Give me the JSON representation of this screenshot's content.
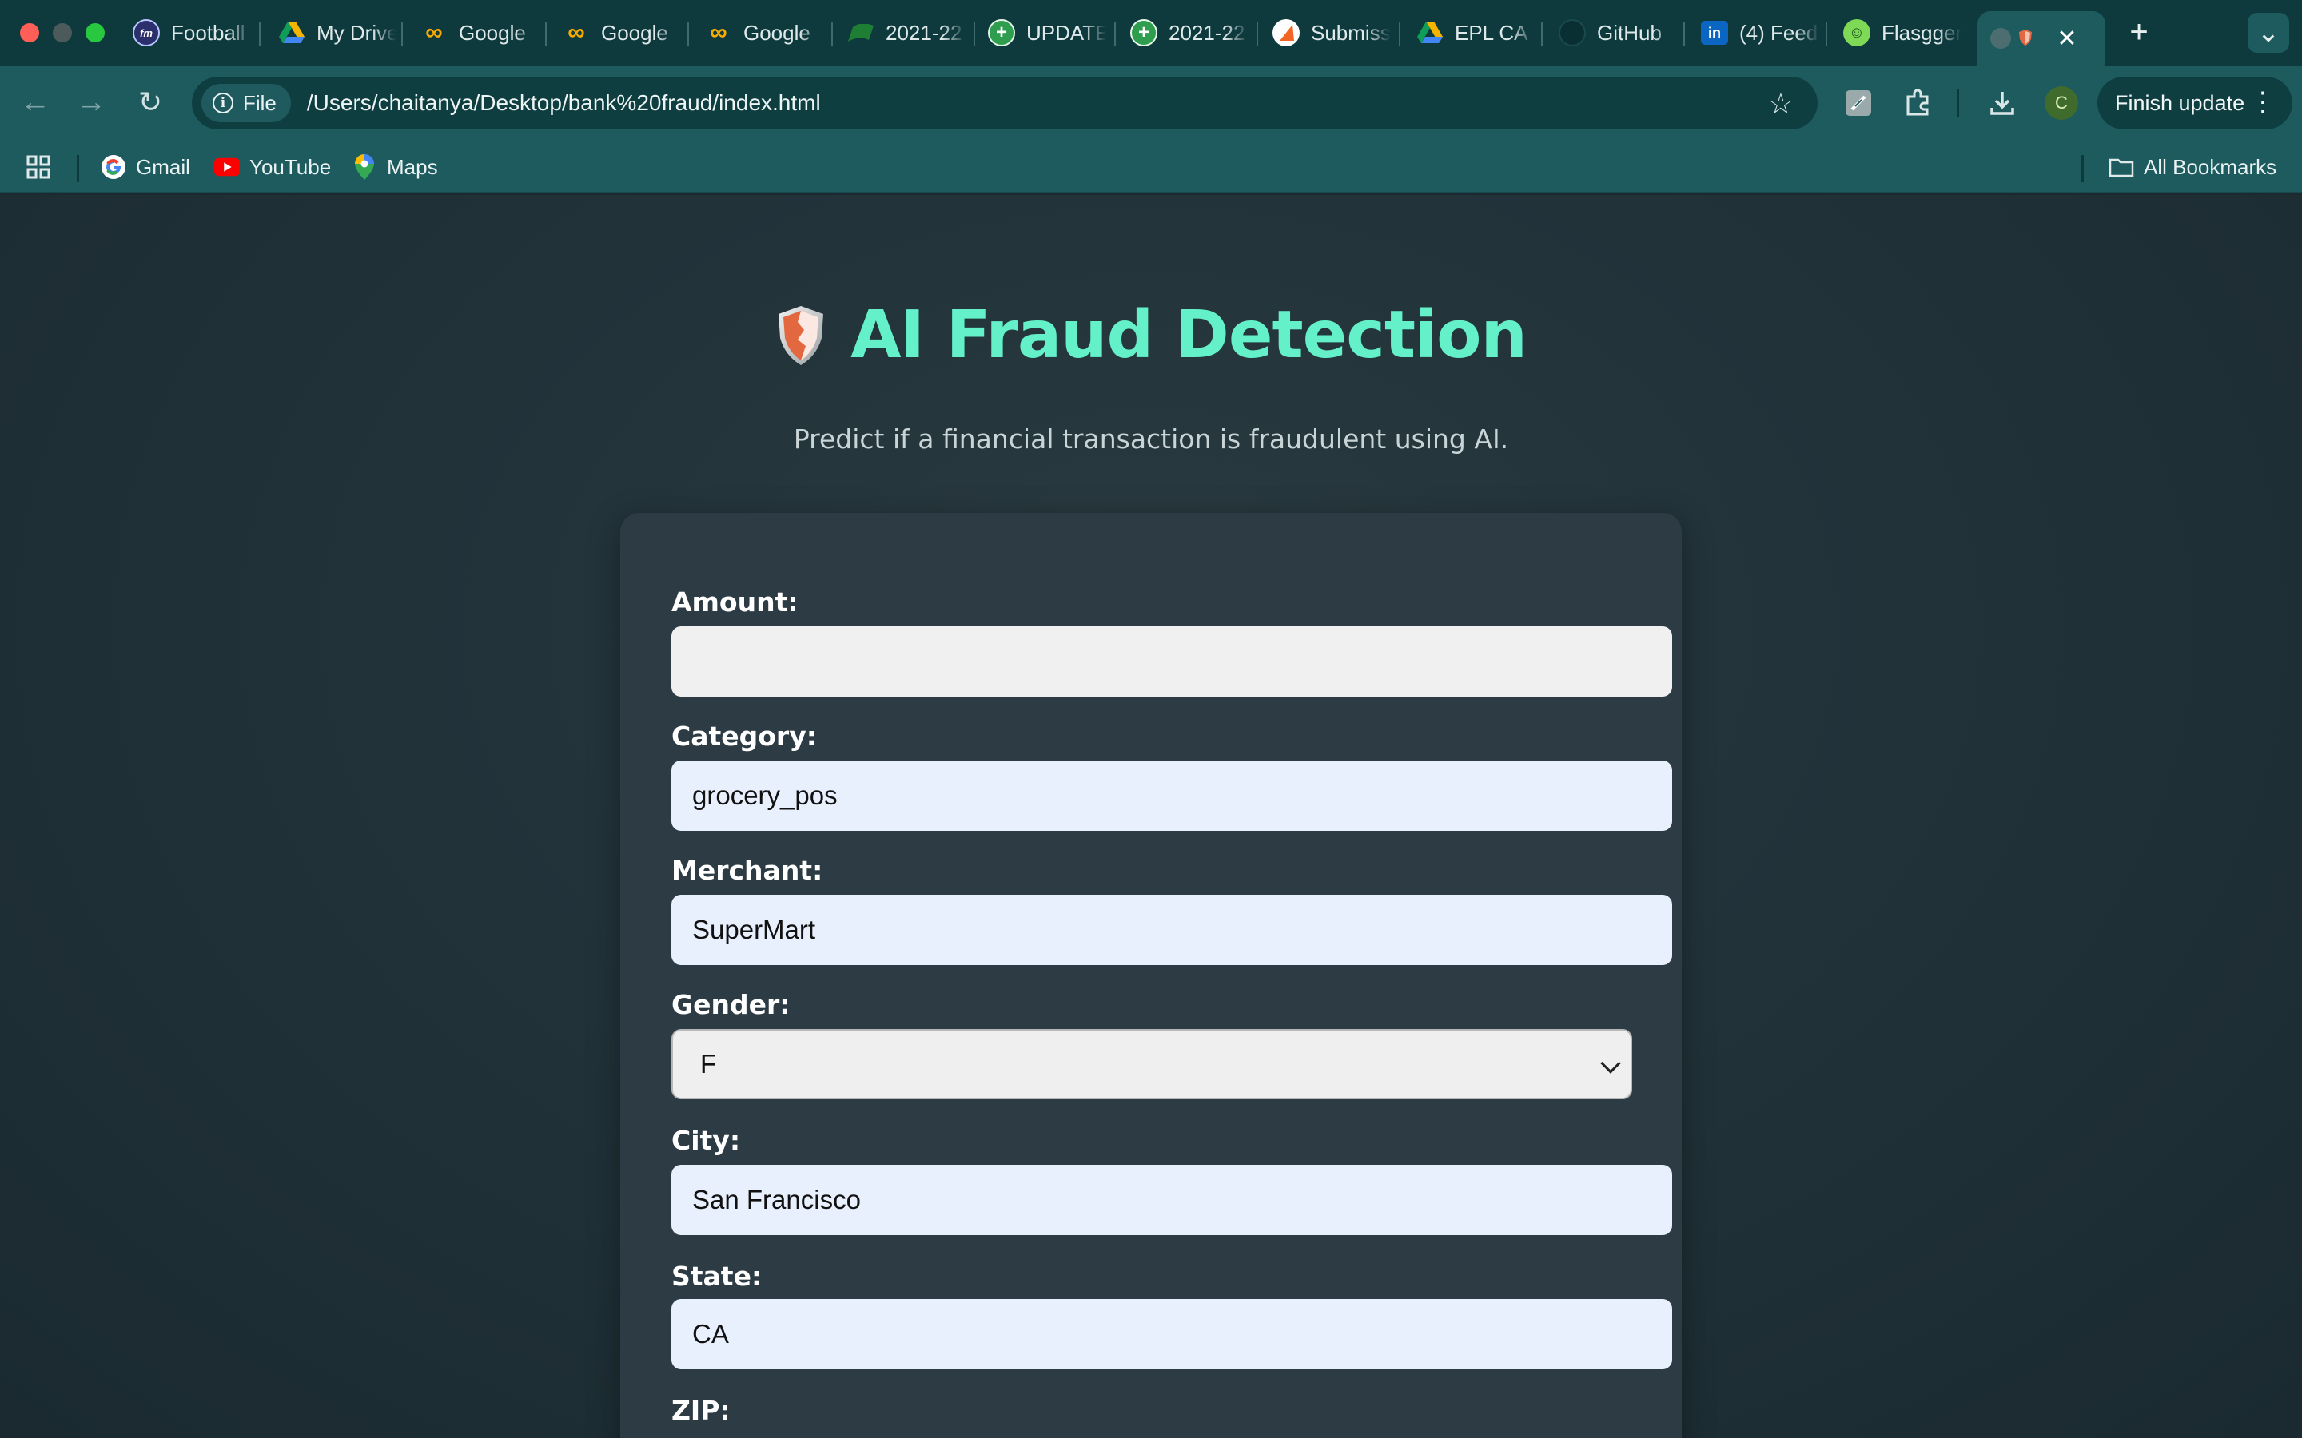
{
  "browser": {
    "tabs": [
      {
        "label": "Football",
        "favicon": "fm-icon",
        "color": "#2b2f6b"
      },
      {
        "label": "My Drive",
        "favicon": "drive-icon",
        "color": "#f4b400"
      },
      {
        "label": "Google",
        "favicon": "colab-icon",
        "color": "#f9ab00"
      },
      {
        "label": "Google",
        "favicon": "colab-icon",
        "color": "#f9ab00"
      },
      {
        "label": "Google",
        "favicon": "colab-icon",
        "color": "#f9ab00"
      },
      {
        "label": "2021-22",
        "favicon": "sheet-icon",
        "color": "#1e7e34"
      },
      {
        "label": "UPDATED",
        "favicon": "cross-icon",
        "color": "#2e9e4e"
      },
      {
        "label": "2021-22",
        "favicon": "cross-icon",
        "color": "#2e9e4e"
      },
      {
        "label": "Submission",
        "favicon": "submit-icon",
        "color": "#f26522"
      },
      {
        "label": "EPL CA",
        "favicon": "drive-icon",
        "color": "#f4b400"
      },
      {
        "label": "GitHub",
        "favicon": "github-icon",
        "color": "#111111"
      },
      {
        "label": "(4) Feed",
        "favicon": "linkedin-icon",
        "color": "#0a66c2"
      },
      {
        "label": "Flasgger",
        "favicon": "flasgger-icon",
        "color": "#7ed957"
      }
    ],
    "active_tab_close": "✕",
    "new_tab": "+",
    "tab_search": "⌄",
    "address": {
      "scheme_chip": "File",
      "url": "/Users/chaitanya/Desktop/bank%20fraud/index.html"
    },
    "profile_initial": "C",
    "finish_update": "Finish update",
    "bookmarks": [
      {
        "label": "Gmail",
        "icon": "google-icon"
      },
      {
        "label": "YouTube",
        "icon": "youtube-icon"
      },
      {
        "label": "Maps",
        "icon": "maps-icon"
      }
    ],
    "all_bookmarks": "All Bookmarks"
  },
  "page": {
    "title": "AI Fraud Detection",
    "subtitle": "Predict if a financial transaction is fraudulent using AI.",
    "form": {
      "amount": {
        "label": "Amount:",
        "value": ""
      },
      "category": {
        "label": "Category:",
        "value": "grocery_pos"
      },
      "merchant": {
        "label": "Merchant:",
        "value": "SuperMart"
      },
      "gender": {
        "label": "Gender:",
        "value": "F"
      },
      "city": {
        "label": "City:",
        "value": "San Francisco"
      },
      "state": {
        "label": "State:",
        "value": "CA"
      },
      "zip": {
        "label": "ZIP:"
      }
    }
  },
  "colors": {
    "accent": "#64f0c8",
    "chrome": "#1d5b5f",
    "card": "#2d3c44"
  }
}
